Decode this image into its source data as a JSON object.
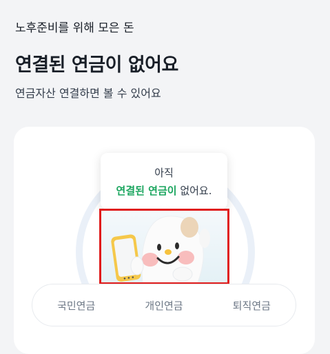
{
  "header": {
    "eyebrow": "노후준비를 위해 모은 돈",
    "title": "연결된 연금이 없어요",
    "description": "연금자산 연결하면 볼 수 있어요"
  },
  "tooltip": {
    "line1": "아직",
    "line2_highlight": "연결된 연금이",
    "line2_rest": " 없어요."
  },
  "tabs": [
    "국민연금",
    "개인연금",
    "퇴직연금"
  ],
  "colors": {
    "accent_green": "#1aa55e",
    "highlight_border": "#e01b1b",
    "background": "#f3f4f6"
  }
}
